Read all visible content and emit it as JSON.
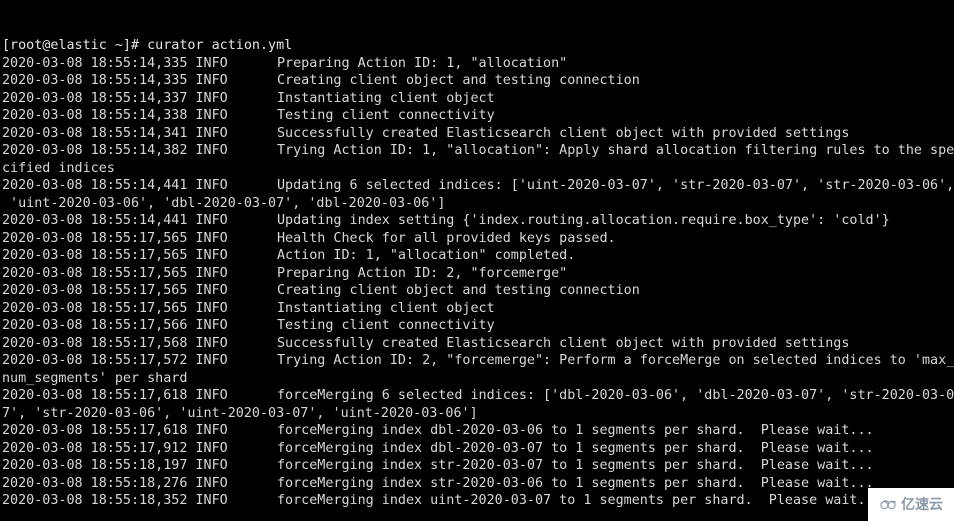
{
  "terminal": {
    "background_color": "#000000",
    "text_color": "#d8d8d8",
    "prompt": "[root@elastic ~]# curator action.yml",
    "log_level": "INFO",
    "columns": 113,
    "lines": [
      {
        "type": "prompt",
        "text": "[root@elastic ~]# curator action.yml"
      },
      {
        "type": "log",
        "ts": "2020-03-08 18:55:14,335 INFO",
        "msg": "Preparing Action ID: 1, \"allocation\""
      },
      {
        "type": "log",
        "ts": "2020-03-08 18:55:14,335 INFO",
        "msg": "Creating client object and testing connection"
      },
      {
        "type": "log",
        "ts": "2020-03-08 18:55:14,337 INFO",
        "msg": "Instantiating client object"
      },
      {
        "type": "log",
        "ts": "2020-03-08 18:55:14,338 INFO",
        "msg": "Testing client connectivity"
      },
      {
        "type": "log",
        "ts": "2020-03-08 18:55:14,341 INFO",
        "msg": "Successfully created Elasticsearch client object with provided settings"
      },
      {
        "type": "log",
        "ts": "2020-03-08 18:55:14,382 INFO",
        "msg": "Trying Action ID: 1, \"allocation\": Apply shard allocation filtering rules to the spe"
      },
      {
        "type": "wrap",
        "text": "cified indices"
      },
      {
        "type": "log",
        "ts": "2020-03-08 18:55:14,441 INFO",
        "msg": "Updating 6 selected indices: ['uint-2020-03-07', 'str-2020-03-07', 'str-2020-03-06',"
      },
      {
        "type": "wrap",
        "text": " 'uint-2020-03-06', 'dbl-2020-03-07', 'dbl-2020-03-06']"
      },
      {
        "type": "log",
        "ts": "2020-03-08 18:55:14,441 INFO",
        "msg": "Updating index setting {'index.routing.allocation.require.box_type': 'cold'}"
      },
      {
        "type": "log",
        "ts": "2020-03-08 18:55:17,565 INFO",
        "msg": "Health Check for all provided keys passed."
      },
      {
        "type": "log",
        "ts": "2020-03-08 18:55:17,565 INFO",
        "msg": "Action ID: 1, \"allocation\" completed."
      },
      {
        "type": "log",
        "ts": "2020-03-08 18:55:17,565 INFO",
        "msg": "Preparing Action ID: 2, \"forcemerge\""
      },
      {
        "type": "log",
        "ts": "2020-03-08 18:55:17,565 INFO",
        "msg": "Creating client object and testing connection"
      },
      {
        "type": "log",
        "ts": "2020-03-08 18:55:17,565 INFO",
        "msg": "Instantiating client object"
      },
      {
        "type": "log",
        "ts": "2020-03-08 18:55:17,566 INFO",
        "msg": "Testing client connectivity"
      },
      {
        "type": "log",
        "ts": "2020-03-08 18:55:17,568 INFO",
        "msg": "Successfully created Elasticsearch client object with provided settings"
      },
      {
        "type": "log",
        "ts": "2020-03-08 18:55:17,572 INFO",
        "msg": "Trying Action ID: 2, \"forcemerge\": Perform a forceMerge on selected indices to 'max_"
      },
      {
        "type": "wrap",
        "text": "num_segments' per shard"
      },
      {
        "type": "log",
        "ts": "2020-03-08 18:55:17,618 INFO",
        "msg": "forceMerging 6 selected indices: ['dbl-2020-03-06', 'dbl-2020-03-07', 'str-2020-03-0"
      },
      {
        "type": "wrap",
        "text": "7', 'str-2020-03-06', 'uint-2020-03-07', 'uint-2020-03-06']"
      },
      {
        "type": "log",
        "ts": "2020-03-08 18:55:17,618 INFO",
        "msg": "forceMerging index dbl-2020-03-06 to 1 segments per shard.  Please wait..."
      },
      {
        "type": "log",
        "ts": "2020-03-08 18:55:17,912 INFO",
        "msg": "forceMerging index dbl-2020-03-07 to 1 segments per shard.  Please wait..."
      },
      {
        "type": "log",
        "ts": "2020-03-08 18:55:18,197 INFO",
        "msg": "forceMerging index str-2020-03-07 to 1 segments per shard.  Please wait..."
      },
      {
        "type": "log",
        "ts": "2020-03-08 18:55:18,276 INFO",
        "msg": "forceMerging index str-2020-03-06 to 1 segments per shard.  Please wait..."
      },
      {
        "type": "log",
        "ts": "2020-03-08 18:55:18,352 INFO",
        "msg": "forceMerging index uint-2020-03-07 to 1 segments per shard.  Please wait..."
      }
    ]
  },
  "watermark": {
    "text": "亿速云",
    "logo_icon": "cloud-icon",
    "background_color": "#ffffff",
    "text_color": "#8b98a8"
  }
}
